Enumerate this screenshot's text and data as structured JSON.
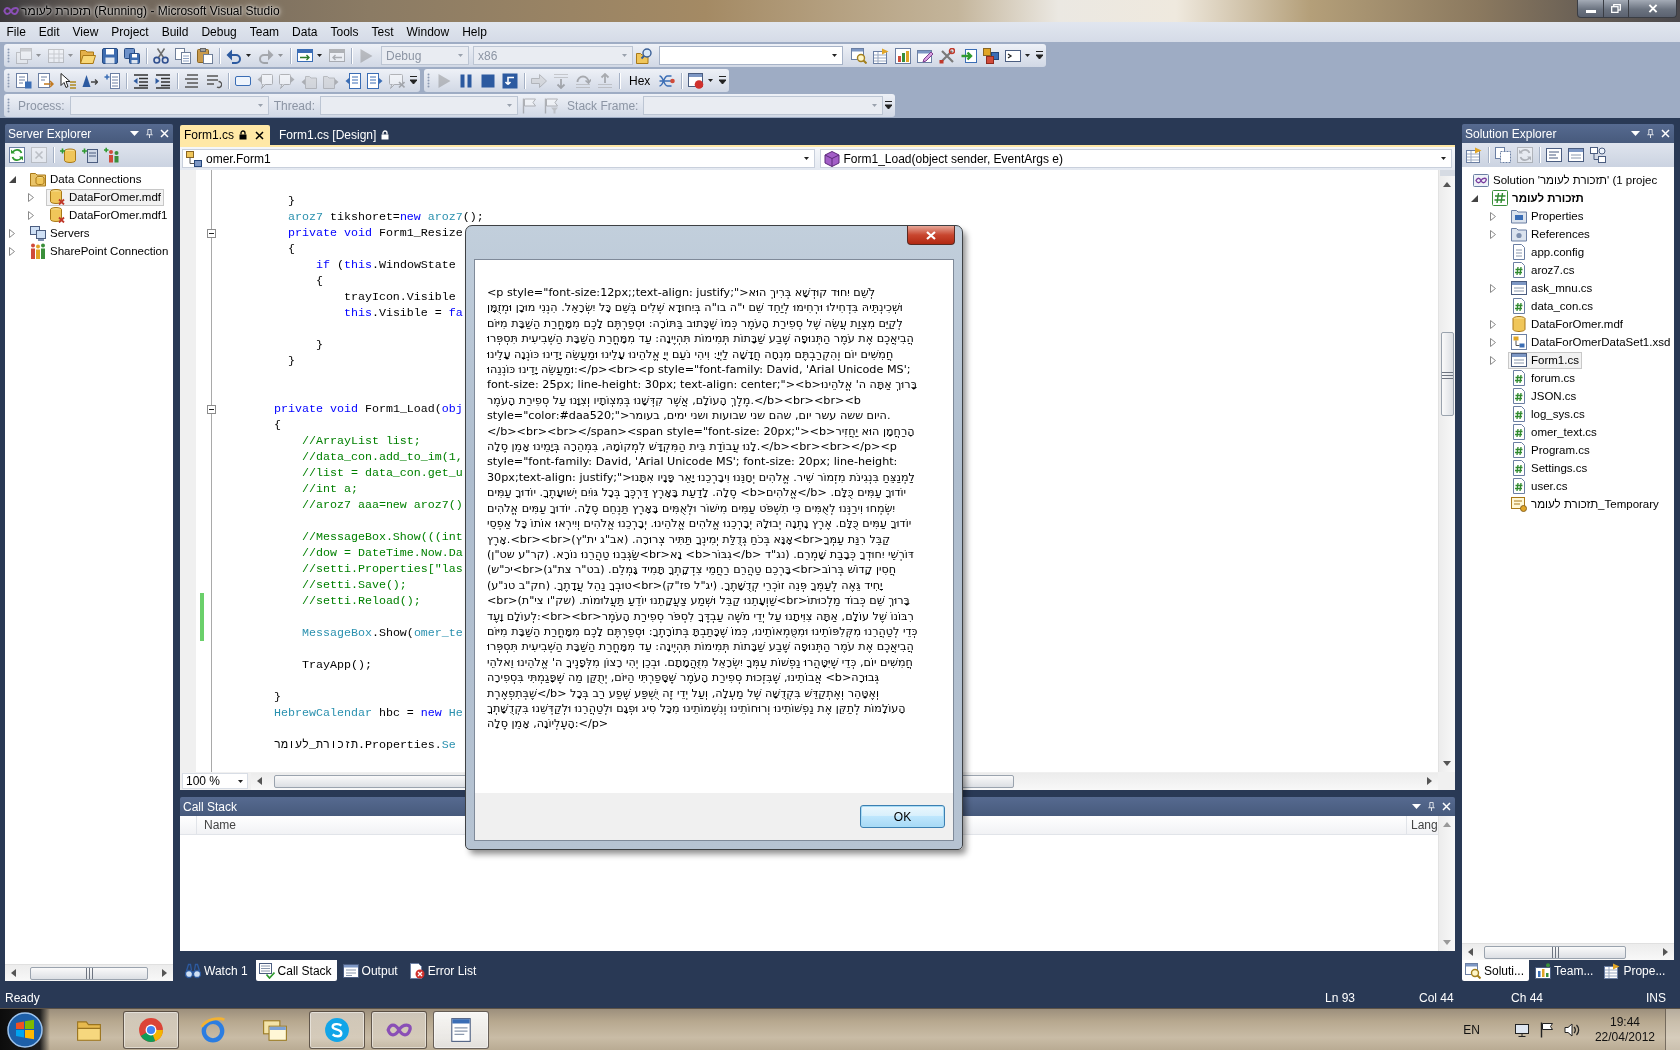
{
  "window": {
    "title": "תזכורת לעומר (Running) - Microsoft Visual Studio"
  },
  "menu": [
    "File",
    "Edit",
    "View",
    "Project",
    "Build",
    "Debug",
    "Team",
    "Data",
    "Tools",
    "Test",
    "Window",
    "Help"
  ],
  "toolbars": [
    {
      "strips": [
        {
          "items": [
            {
              "kind": "split",
              "disabled": true
            },
            {
              "kind": "split",
              "disabled": true
            },
            {
              "kind": "button",
              "disabled": false
            },
            {
              "kind": "button",
              "disabled": false
            },
            {
              "kind": "button",
              "disabled": false
            },
            {
              "kind": "separator"
            },
            {
              "kind": "button",
              "disabled": false
            },
            {
              "kind": "button",
              "disabled": false
            },
            {
              "kind": "button",
              "disabled": false
            },
            {
              "kind": "separator"
            },
            {
              "kind": "split",
              "disabled": false
            },
            {
              "kind": "split",
              "disabled": true
            },
            {
              "kind": "separator"
            },
            {
              "kind": "split",
              "disabled": false
            },
            {
              "kind": "button",
              "disabled": true
            },
            {
              "kind": "separator"
            },
            {
              "kind": "button",
              "disabled": true
            },
            {
              "kind": "dropdown",
              "value": "Debug",
              "disabled": true
            },
            {
              "kind": "dropdown",
              "value": "x86",
              "disabled": true
            },
            {
              "kind": "button",
              "disabled": false
            },
            {
              "kind": "combo",
              "disabled": false
            },
            {
              "kind": "button",
              "disabled": false
            },
            {
              "kind": "button",
              "disabled": false
            },
            {
              "kind": "button",
              "disabled": false
            },
            {
              "kind": "button",
              "disabled": false
            },
            {
              "kind": "button",
              "disabled": false
            },
            {
              "kind": "button",
              "disabled": false
            },
            {
              "kind": "button",
              "disabled": false
            },
            {
              "kind": "split",
              "disabled": false
            }
          ]
        }
      ]
    },
    {
      "strips": [
        {
          "items": [
            {
              "kind": "button",
              "disabled": false
            },
            {
              "kind": "button",
              "disabled": false
            },
            {
              "kind": "button",
              "disabled": false
            },
            {
              "kind": "button",
              "disabled": false
            },
            {
              "kind": "button",
              "disabled": false
            },
            {
              "kind": "separator"
            },
            {
              "kind": "button",
              "disabled": false
            },
            {
              "kind": "button",
              "disabled": false
            },
            {
              "kind": "separator"
            },
            {
              "kind": "button",
              "disabled": false
            },
            {
              "kind": "button",
              "disabled": false
            },
            {
              "kind": "separator"
            },
            {
              "kind": "button",
              "disabled": false
            },
            {
              "kind": "button",
              "disabled": true
            },
            {
              "kind": "button",
              "disabled": true
            },
            {
              "kind": "button",
              "disabled": true
            },
            {
              "kind": "button",
              "disabled": true
            },
            {
              "kind": "button",
              "disabled": false
            },
            {
              "kind": "button",
              "disabled": false
            },
            {
              "kind": "button",
              "disabled": true
            }
          ]
        },
        {
          "items": [
            {
              "kind": "button",
              "disabled": true
            },
            {
              "kind": "button",
              "disabled": false
            },
            {
              "kind": "button",
              "disabled": false
            },
            {
              "kind": "button",
              "disabled": false
            },
            {
              "kind": "separator"
            },
            {
              "kind": "button",
              "disabled": true
            },
            {
              "kind": "button",
              "disabled": true
            },
            {
              "kind": "button",
              "disabled": true
            },
            {
              "kind": "button",
              "disabled": true
            },
            {
              "kind": "separator"
            },
            {
              "kind": "text",
              "text": "Hex",
              "disabled": false
            },
            {
              "kind": "button",
              "disabled": false
            },
            {
              "kind": "separator"
            },
            {
              "kind": "split",
              "disabled": false
            }
          ]
        }
      ]
    },
    {
      "strips": [
        {
          "items": [
            {
              "kind": "label",
              "text": "Process:",
              "disabled": true
            },
            {
              "kind": "dropdown",
              "disabled": true
            },
            {
              "kind": "label",
              "text": "Thread:",
              "disabled": true
            },
            {
              "kind": "dropdown",
              "disabled": true
            },
            {
              "kind": "button",
              "disabled": true
            },
            {
              "kind": "button",
              "disabled": true
            },
            {
              "kind": "label",
              "text": "Stack Frame:",
              "disabled": true
            },
            {
              "kind": "dropdown",
              "disabled": true
            }
          ]
        }
      ]
    }
  ],
  "server_explorer": {
    "title": "Server Explorer",
    "toolbar": [
      {
        "kind": "button",
        "disabled": false
      },
      {
        "kind": "button",
        "disabled": true
      },
      {
        "kind": "separator"
      },
      {
        "kind": "button",
        "disabled": false
      },
      {
        "kind": "button",
        "disabled": false
      },
      {
        "kind": "button",
        "disabled": false
      }
    ],
    "tree": [
      {
        "label": "Data Connections",
        "kind": "connections",
        "expanded": true,
        "selected": false,
        "children": [
          {
            "label": "DataForOmer.mdf",
            "kind": "database-x",
            "expanded": false,
            "selected": true
          },
          {
            "label": "DataForOmer.mdf1",
            "kind": "database-x",
            "expanded": false,
            "selected": false
          }
        ]
      },
      {
        "label": "Servers",
        "kind": "servers",
        "expanded": false,
        "selected": false
      },
      {
        "label": "SharePoint Connection",
        "kind": "sharepoint",
        "expanded": false,
        "selected": false
      }
    ]
  },
  "editor": {
    "tabs": [
      {
        "label": "Form1.cs",
        "selected": true,
        "locked": true
      },
      {
        "label": "Form1.cs [Design]",
        "selected": false,
        "locked": true
      }
    ],
    "type_dropdown": "omer.Form1",
    "member_dropdown": "Form1_Load(object sender, EventArgs e)",
    "lines": [
      {
        "kind": "blank",
        "changed": false
      },
      {
        "kind": "code",
        "changed": false,
        "tokens": [
          {
            "kind": "plain",
            "text": "          }"
          }
        ]
      },
      {
        "kind": "code",
        "changed": false,
        "tokens": [
          {
            "kind": "type",
            "text": "          aroz7"
          },
          {
            "kind": "plain",
            "text": " tikshoret="
          },
          {
            "kind": "keyword",
            "text": "new"
          },
          {
            "kind": "type",
            "text": " aroz7"
          },
          {
            "kind": "plain",
            "text": "();"
          }
        ]
      },
      {
        "kind": "code",
        "changed": false,
        "expanded": true,
        "tokens": [
          {
            "kind": "keyword",
            "text": "          private"
          },
          {
            "kind": "keyword",
            "text": " void"
          },
          {
            "kind": "plain",
            "text": " Form1_Resize"
          }
        ]
      },
      {
        "kind": "code",
        "changed": false,
        "tokens": [
          {
            "kind": "plain",
            "text": "          {"
          }
        ]
      },
      {
        "kind": "code",
        "changed": false,
        "tokens": [
          {
            "kind": "keyword",
            "text": "              if"
          },
          {
            "kind": "plain",
            "text": " ("
          },
          {
            "kind": "keyword",
            "text": "this"
          },
          {
            "kind": "plain",
            "text": ".WindowState"
          }
        ]
      },
      {
        "kind": "code",
        "changed": false,
        "tokens": [
          {
            "kind": "plain",
            "text": "              {"
          }
        ]
      },
      {
        "kind": "code",
        "changed": false,
        "tokens": [
          {
            "kind": "plain",
            "text": "                  trayIcon.Visible"
          }
        ]
      },
      {
        "kind": "code",
        "changed": false,
        "tokens": [
          {
            "kind": "keyword",
            "text": "                  this"
          },
          {
            "kind": "plain",
            "text": ".Visible = "
          },
          {
            "kind": "keyword",
            "text": "fa"
          }
        ]
      },
      {
        "kind": "blank",
        "changed": false
      },
      {
        "kind": "code",
        "changed": false,
        "tokens": [
          {
            "kind": "plain",
            "text": "              }"
          }
        ]
      },
      {
        "kind": "code",
        "changed": false,
        "tokens": [
          {
            "kind": "plain",
            "text": "          }"
          }
        ]
      },
      {
        "kind": "blank",
        "changed": false
      },
      {
        "kind": "blank",
        "changed": false
      },
      {
        "kind": "code",
        "changed": false,
        "expanded": true,
        "tokens": [
          {
            "kind": "keyword",
            "text": "        private"
          },
          {
            "kind": "keyword",
            "text": " void"
          },
          {
            "kind": "plain",
            "text": " Form1_Load("
          },
          {
            "kind": "keyword",
            "text": "obj"
          }
        ]
      },
      {
        "kind": "code",
        "changed": false,
        "tokens": [
          {
            "kind": "plain",
            "text": "        {"
          }
        ]
      },
      {
        "kind": "code",
        "changed": false,
        "tokens": [
          {
            "kind": "comment",
            "text": "            //ArrayList list;"
          }
        ]
      },
      {
        "kind": "code",
        "changed": false,
        "tokens": [
          {
            "kind": "comment",
            "text": "            //data_con.add_to_im(1,"
          }
        ]
      },
      {
        "kind": "code",
        "changed": false,
        "tokens": [
          {
            "kind": "comment",
            "text": "            //list = data_con.get_u"
          }
        ]
      },
      {
        "kind": "code",
        "changed": false,
        "tokens": [
          {
            "kind": "comment",
            "text": "            //int a;"
          }
        ]
      },
      {
        "kind": "code",
        "changed": false,
        "tokens": [
          {
            "kind": "comment",
            "text": "            //aroz7 aaa=new aroz7()"
          }
        ]
      },
      {
        "kind": "blank",
        "changed": false
      },
      {
        "kind": "code",
        "changed": false,
        "tokens": [
          {
            "kind": "comment",
            "text": "            //MessageBox.Show(((int"
          }
        ]
      },
      {
        "kind": "code",
        "changed": false,
        "tokens": [
          {
            "kind": "comment",
            "text": "            //dow = DateTime.Now.Da"
          }
        ]
      },
      {
        "kind": "code",
        "changed": false,
        "tokens": [
          {
            "kind": "comment",
            "text": "            //setti.Properties[\"las"
          }
        ]
      },
      {
        "kind": "code",
        "changed": false,
        "tokens": [
          {
            "kind": "comment",
            "text": "            //setti.Save();"
          }
        ]
      },
      {
        "kind": "code",
        "changed": true,
        "tokens": [
          {
            "kind": "comment",
            "text": "            //setti.Reload();"
          }
        ]
      },
      {
        "kind": "blank",
        "changed": true
      },
      {
        "kind": "code",
        "changed": true,
        "tokens": [
          {
            "kind": "type",
            "text": "            MessageBox"
          },
          {
            "kind": "plain",
            "text": ".Show("
          },
          {
            "kind": "type",
            "text": "omer_te"
          }
        ]
      },
      {
        "kind": "blank",
        "changed": false
      },
      {
        "kind": "code",
        "changed": false,
        "tokens": [
          {
            "kind": "plain",
            "text": "            TrayApp();"
          }
        ]
      },
      {
        "kind": "blank",
        "changed": false
      },
      {
        "kind": "code",
        "changed": false,
        "tokens": [
          {
            "kind": "plain",
            "text": "        }"
          }
        ]
      },
      {
        "kind": "code",
        "changed": false,
        "tokens": [
          {
            "kind": "type",
            "text": "        HebrewCalendar"
          },
          {
            "kind": "plain",
            "text": " hbc = "
          },
          {
            "kind": "keyword",
            "text": "new"
          },
          {
            "kind": "type",
            "text": " He"
          }
        ]
      },
      {
        "kind": "blank",
        "changed": false
      },
      {
        "kind": "code",
        "changed": false,
        "tokens": [
          {
            "kind": "plain",
            "text": "        תזכורת_לעומר.Properties."
          },
          {
            "kind": "type",
            "text": "Se"
          }
        ]
      }
    ],
    "zoom": "100 %"
  },
  "call_stack": {
    "title": "Call Stack",
    "columns": [
      "Name",
      "Lang"
    ]
  },
  "tool_tabs": [
    {
      "label": "Watch 1",
      "kind": "watch",
      "selected": false
    },
    {
      "label": "Call Stack",
      "kind": "callstack",
      "selected": true
    },
    {
      "label": "Output",
      "kind": "output",
      "selected": false
    },
    {
      "label": "Error List",
      "kind": "errors",
      "selected": false
    }
  ],
  "solution_explorer": {
    "title": "Solution Explorer",
    "toolbar": [
      {
        "kind": "button",
        "disabled": false
      },
      {
        "kind": "separator"
      },
      {
        "kind": "button",
        "disabled": false
      },
      {
        "kind": "button",
        "disabled": true
      },
      {
        "kind": "separator"
      },
      {
        "kind": "button",
        "disabled": false
      },
      {
        "kind": "button",
        "disabled": false
      },
      {
        "kind": "button",
        "disabled": false
      }
    ],
    "tree": [
      {
        "label": "Solution 'תזכורת לעומר'‎ (1 projec",
        "kind": "solution",
        "selected": false,
        "children": [
          {
            "label": "תזכורת לעומר",
            "kind": "project",
            "expanded": true,
            "selected": false,
            "children": [
              {
                "label": "Properties",
                "kind": "properties",
                "expanded": false,
                "selected": false
              },
              {
                "label": "References",
                "kind": "references",
                "expanded": false,
                "selected": false
              },
              {
                "label": "app.config",
                "kind": "config",
                "selected": false
              },
              {
                "label": "aroz7.cs",
                "kind": "cs",
                "selected": false
              },
              {
                "label": "ask_mnu.cs",
                "kind": "form",
                "expanded": false,
                "selected": false
              },
              {
                "label": "data_con.cs",
                "kind": "cs",
                "selected": false
              },
              {
                "label": "DataForOmer.mdf",
                "kind": "mdf",
                "expanded": false,
                "selected": false
              },
              {
                "label": "DataForOmerDataSet1.xsd",
                "kind": "dataset",
                "expanded": false,
                "selected": false
              },
              {
                "label": "Form1.cs",
                "kind": "form",
                "expanded": false,
                "selected": true
              },
              {
                "label": "forum.cs",
                "kind": "cs",
                "selected": false
              },
              {
                "label": "JSON.cs",
                "kind": "cs",
                "selected": false
              },
              {
                "label": "log_sys.cs",
                "kind": "cs",
                "selected": false
              },
              {
                "label": "omer_text.cs",
                "kind": "cs",
                "selected": false
              },
              {
                "label": "Program.cs",
                "kind": "cs",
                "selected": false
              },
              {
                "label": "Settings.cs",
                "kind": "cs",
                "selected": false
              },
              {
                "label": "user.cs",
                "kind": "cs",
                "selected": false
              },
              {
                "label": "תזכורת לעומר_Temporary",
                "kind": "key",
                "selected": false
              }
            ]
          }
        ]
      }
    ],
    "tabs": [
      {
        "label": "Soluti...",
        "kind": "solution",
        "selected": true
      },
      {
        "label": "Team...",
        "kind": "team",
        "selected": false
      },
      {
        "label": "Prope...",
        "kind": "properties",
        "selected": false
      }
    ]
  },
  "dialog": {
    "message": "<p style=\"font-size:12px;;text-align: justify;\">לְשֵׁם יִחוּד קוּדְשָׁא בְּרִיךְ הוּא וּשְׁכִינְתֵּיהּ בִּדְחִילוּ וּרְחִימוּ לְיַחֵד שֵׁם י\"ה בו\"ה בְּיִחוּדָא שְׁלִים בְּשֵׁם כָּל יִשְׂרָאֵל. הִנְנִי מוּכָן וּמְזֻמָּן לְקַיֵּם מִצְוַת עֲשֵׂה שֶׁל סְפִירַת הָעֹמֶר כְּמוֹ שֶׁכָּתוּב בַּתּוֹרָה: וּסְפַרְתֶּם לָכֶם מִמָּחֳרַת הַשַּׁבָּת מִיּוֹם הֲבִיאֲכֶם אֶת עֹמֶר הַתְּנוּפָה שֶׁבַע שַׁבָּתוֹת תְּמִימוֹת תִּהְיֶינָה: עַד מִמָּחֳרַת הַשַּׁבָּת הַשְּׁבִיעִית תִּסְפְּרוּ חֲמִשִּׁים יוֹם וְהִקְרַבְתֶּם מִנְחָה חֲדָשָׁה לַיְיָ: וִיהִי נֹעַם יְיָ אֱלֹהֵינוּ עָלֵינוּ וּמַעֲשֵׂה יָדֵינוּ כּוֹנְנָה עָלֵינוּ וּמַעֲשֵׂה יָדֵינוּ כּוֹנְנֵהוּ:</p><br><p style=\"font-family: David, 'Arial Unicode MS'; font-size: 25px; line-height: 30px; text-align: center;\"><b>בָּרוּךְ אַתָּה ה' אֱלֹהֵינוּ מֶלֶךְ הָעוֹלָם, אֲשֶׁר קִדְּשָׁנוּ בְּמִצְוֹתָיו וְצִוָּנוּ עַל סְפִירַת הָעֹמֶר.</b><br><br><b style=\"color:#daa520;\">היום ששה עשר יום, שהם שני שבועות ושני ימים, בעומר.</b><br><br></span><span style=\"font-size: 20px;\"><b>הָרַחֲמָן הוּא יַחֲזִיר לָנוּ עֲבוֹדַת בֵּית הַמִּקְדָּשׁ לִמְקוֹמָהּ, בִּמְהֵרָה בְּיָמֵינוּ אָמֵן סֶלָה.</b><br><br></p><p style=\"font-family: David, 'Arial Unicode MS'; font-size: 20px; line-height: 30px;text-align: justify;\">לַמְנַצֵּחַ בִּנְגִינֹת מִזְמוֹר שִׁיר. אֱלֹהִים יְחָנֵּנוּ וִיבָרְכֵנוּ יָאֵר פָּנָיו אִתָּנוּ סֶלָה. לָדַעַת בָּאָרֶץ דַּרְכֶּךָ בְּכָל גּוֹיִם יְשׁוּעָתֶךָ. יוֹדוּךָ עַמִּים <b>אֱלֹהִים</b> יוֹדוּךָ עַמִּים כֻּלָּם. יִשְׂמְחוּ וִירַנְּנוּ לְאֻמִּים כִּי תִשְׁפֹּט עַמִּים מִישׁוֹר וּלְאֻמִּים בָּאָרֶץ תַּנְחֵם סֶלָה. יוֹדוּךָ עַמִּים אֱלֹהִים יוֹדוּךָ עַמִּים כֻּלָּם. אֶרֶץ נָתְנָה יְבוּלָהּ יְבָרְכֵנוּ אֱלֹהִים אֱלֹהֵינוּ. יְבָרְכֵנוּ אֱלֹהִים וְיִירְאוּ אוֹתוֹ כָּל אַפְסֵי אָרֶץ.<br><br>אָנָּא בְּכֹחַ גְּדֻלַּת יְמִינְךָ תַּתִּיר צְרוּרָה. (אב\"ג ית\"ץ)<br>קַבֵּל רִנַּת עַמְּךָ שַׂגְּבֵנוּ טַהֲרֵנוּ נוֹרָא. (קר\"ע שט\"ן)<br>נָא <b>גִבּוֹר</b> דּוֹרְשֵׁי יִחוּדְךָ כְּבָבַת שָׁמְרֵם. (נג\"ד יכ\"ש)<br>בָּרְכֵם טַהֲרֵם רַחֲמֵי צִדְקָתְךָ תָּמִיד גָּמְלֵם. (בט\"ר צת\"ג)<br>חֲסִין קָדוֹשׁ בְּרוֹב טוּבְךָ נַהֵל עֲדָתֶךָ. (חק\"ב טנ\"ע)<br>יָחִיד גֵּאֶה לְעַמְּךָ פְּנֵה זוֹכְרֵי קְדֻשָּׁתֶךָ. (יג\"ל פז\"ק)<br>שַׁוְעָתֵנוּ קַבֵּל וּשְׁמַע צַעֲקָתֵנוּ יוֹדֵעַ תַּעֲלוּמוֹת. (שק\"ו צי\"ת)<br>בָּרוּךְ שֵׁם כְּבוֹד מַלְכוּתוֹ לְעוֹלָם וָעֶד:<br><br>רִבּוֹנוֹ שֶׁל עוֹלָם, אַתָּה צִוִּיתָנוּ עַל יְדֵי מֹשֶׁה עַבְדֶּךָ לִסְפֹּר סְפִירַת הָעֹמֶר כְּדֵי לְטַהֲרֵנוּ מִקְּלִפּוֹתֵינוּ וּמִטֻּמְאוֹתֵינוּ, כְּמוֹ שֶׁכָּתַבְתָּ בְּתוֹרָתֶךָ: וּסְפַרְתֶּם לָכֶם מִמָּחֳרַת הַשַּׁבָּת מִיּוֹם הֲבִיאֲכֶם אֶת עֹמֶר הַתְּנוּפָה שֶׁבַע שַׁבָּתוֹת תְּמִימוֹת תִּהְיֶינָה: עַד מִמָּחֳרַת הַשַּׁבָּת הַשְּׁבִיעִית תִּסְפְּרוּ חֲמִשִּׁים יוֹם, כְּדֵי שֶׁיִּטָּהֲרוּ נַפְשׁוֹת עַמְּךָ יִשְׂרָאֵל מִזֻּהֲמָתָם. וּבְכֵן יְהִי רָצוֹן מִלְּפָנֶיךָ ה' אֱלֹהֵינוּ וֵאלֹהֵי אֲבוֹתֵינוּ, שֶׁבִּזְכוּת סְפִירַת הָעֹמֶר שֶׁסָּפַרְתִּי הַיּוֹם, יְתֻקַּן מַה שֶּׁפָּגַמְתִּי בִּסְפִירָה <b>גְּבוּרָה שֶׁבְּתִפְאֶרֶת</b> וְאֶטָּהֵר וְאֶתְקַדֵּשׁ בִּקְדֻשָּׁה שֶׁל מַעְלָה, וְעַל יְדֵי זֶה יֻשְׁפַּע שֶׁפַע רַב בְּכָל הָעוֹלָמוֹת לְתַקֵּן אֶת נַפְשׁוֹתֵינוּ וְרוּחוֹתֵינוּ וְנִשְׁמוֹתֵינוּ מִכָּל סִיג וּפְגָם וּלְטַהֲרֵנוּ וּלְקַדְּשֵׁנוּ בִּקְדֻשָּׁתְךָ הָעֶלְיוֹנָה, אָמֵן סֶלָה:</p>",
    "buttons": [
      {
        "label": "OK",
        "focused": true
      }
    ]
  },
  "status_bar": {
    "message": "Ready",
    "line": "Ln 93",
    "column": "Col 44",
    "char": "Ch 44",
    "mode": "INS"
  },
  "taskbar": {
    "buttons": [
      {
        "kind": "folder",
        "open": false,
        "selected": false
      },
      {
        "kind": "ring",
        "open": true,
        "selected": false
      },
      {
        "kind": "swoosh",
        "open": false,
        "selected": false
      },
      {
        "kind": "windows",
        "open": false,
        "selected": false
      },
      {
        "kind": "swirl",
        "open": true,
        "selected": false
      },
      {
        "kind": "infinity",
        "open": true,
        "selected": false
      },
      {
        "kind": "document",
        "open": true,
        "selected": true
      }
    ],
    "language": "EN",
    "time": "19:44",
    "date": "22/04/2012"
  }
}
